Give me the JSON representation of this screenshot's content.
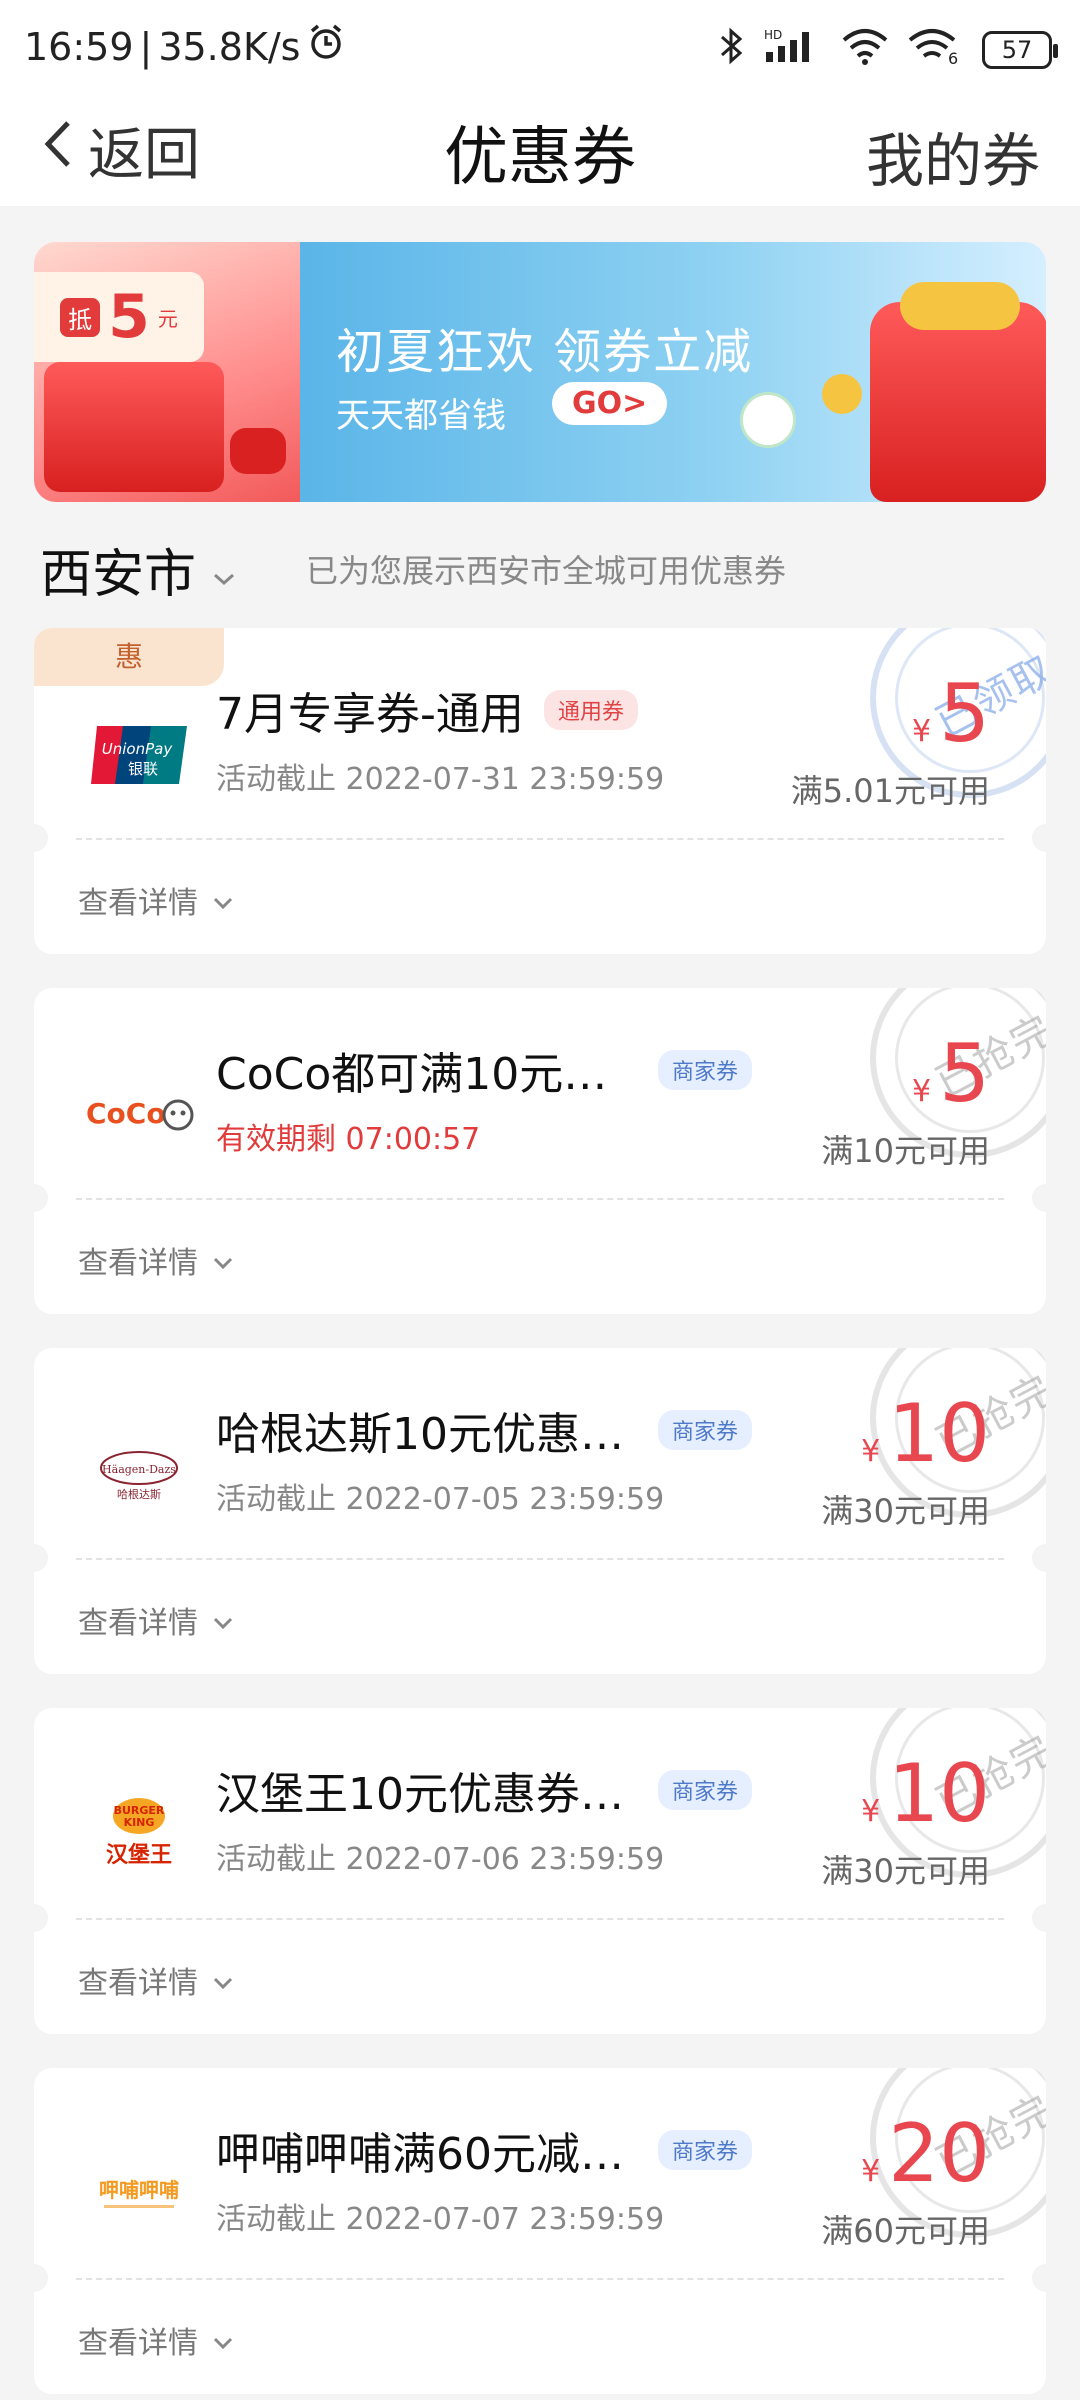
{
  "status": {
    "time": "16:59",
    "separator": "|",
    "speed": "35.8K/s",
    "battery": "57",
    "hd": "HD"
  },
  "nav": {
    "back_label": "返回",
    "title": "优惠券",
    "right_label": "我的券"
  },
  "banner": {
    "headline": "初夏狂欢 领券立减",
    "subline": "天天都省钱",
    "go_label": "GO>",
    "side_text": "抵",
    "side_amount": "5",
    "side_unit": "元"
  },
  "city": {
    "name": "西安市",
    "hint": "已为您展示西安市全城可用优惠券"
  },
  "coupons": [
    {
      "corner_badge": "惠",
      "brand": "UnionPay 银联",
      "title": "7月专享券-通用",
      "tag": "通用券",
      "subtitle": "活动截止 2022-07-31 23:59:59",
      "currency": "¥",
      "amount": "5",
      "condition": "满5.01元可用",
      "stamp": "已领取",
      "detail_label": "查看详情"
    },
    {
      "brand": "CoCo 都可",
      "title": "CoCo都可满10元…",
      "tag": "商家券",
      "subtitle": "有效期剩 07:00:57",
      "currency": "¥",
      "amount": "5",
      "condition": "满10元可用",
      "stamp": "已抢完",
      "detail_label": "查看详情"
    },
    {
      "brand": "Häagen-Dazs 哈根达斯",
      "title": "哈根达斯10元优惠…",
      "tag": "商家券",
      "subtitle": "活动截止 2022-07-05 23:59:59",
      "currency": "¥",
      "amount": "10",
      "condition": "满30元可用",
      "stamp": "已抢完",
      "detail_label": "查看详情"
    },
    {
      "brand": "BURGER KING 汉堡王",
      "title": "汉堡王10元优惠券…",
      "tag": "商家券",
      "subtitle": "活动截止 2022-07-06 23:59:59",
      "currency": "¥",
      "amount": "10",
      "condition": "满30元可用",
      "stamp": "已抢完",
      "detail_label": "查看详情"
    },
    {
      "brand": "呷哺呷哺",
      "title": "呷哺呷哺满60元减…",
      "tag": "商家券",
      "subtitle": "活动截止 2022-07-07 23:59:59",
      "currency": "¥",
      "amount": "20",
      "condition": "满60元可用",
      "stamp": "已抢完",
      "detail_label": "查看详情"
    }
  ],
  "colors": {
    "accent_red": "#e9474f",
    "merchant_tag": "#4f79c9",
    "banner_blue": "#5ab5e8"
  },
  "icons": [
    "back-chevron-icon",
    "alarm-icon",
    "bluetooth-icon",
    "signal-icon",
    "wifi-icon",
    "battery-icon",
    "chevron-down-icon"
  ]
}
